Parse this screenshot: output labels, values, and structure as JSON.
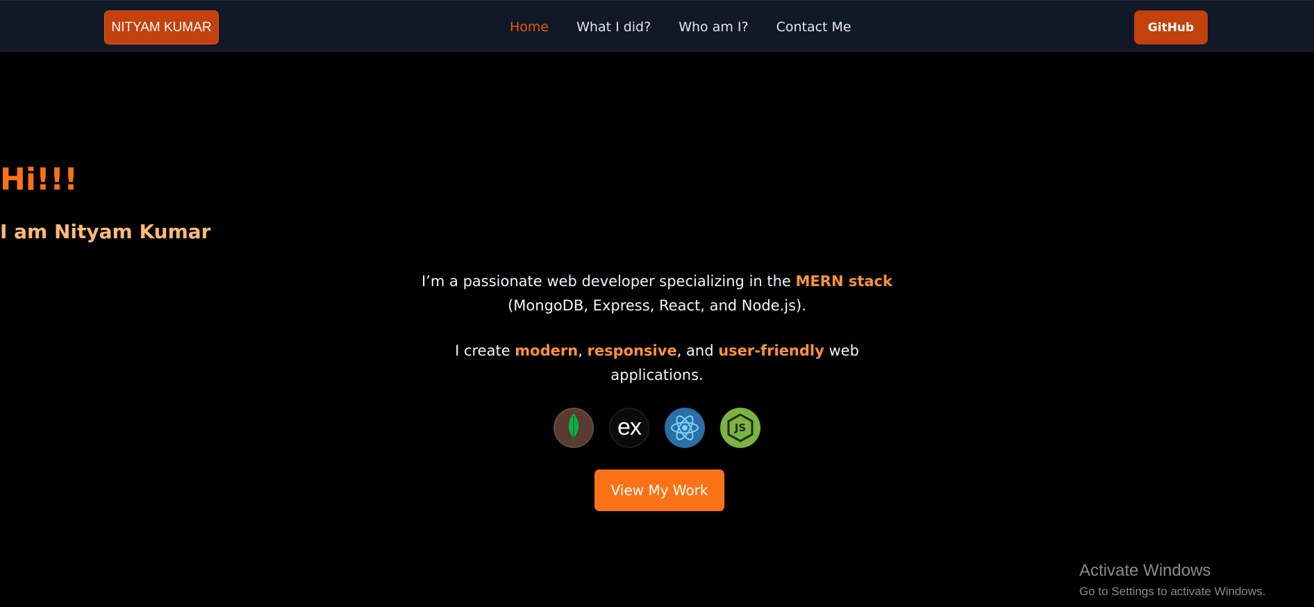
{
  "navbar": {
    "brand": "NITYAM KUMAR",
    "links": [
      {
        "label": "Home",
        "active": true
      },
      {
        "label": "What I did?"
      },
      {
        "label": "Who am I?"
      },
      {
        "label": "Contact Me"
      }
    ],
    "github_label": "GitHub"
  },
  "hero": {
    "greeting": "Hi!!!",
    "intro": "I am Nityam Kumar",
    "para1": {
      "text_before": "I’m a passionate web developer specializing in the ",
      "highlight": "MERN stack",
      "text_after": " (MongoDB, Express, React, and Node.js)."
    },
    "para2": {
      "text_1": "I create ",
      "hl_1": "modern",
      "text_2": ", ",
      "hl_2": "responsive",
      "text_3": ", and ",
      "hl_3": "user-friendly",
      "text_4": " web applications."
    },
    "tech_icons": [
      "mongodb-icon",
      "express-icon",
      "react-icon",
      "nodejs-icon"
    ],
    "express_glyph": "ex",
    "node_glyph": "JS",
    "cta_label": "View My Work"
  },
  "watermark": {
    "title": "Activate Windows",
    "subtitle": "Go to Settings to activate Windows."
  },
  "colors": {
    "accent": "#f97316",
    "accent_dark": "#c2410c",
    "nav_bg": "#111827",
    "subtitle": "#fdba74"
  }
}
